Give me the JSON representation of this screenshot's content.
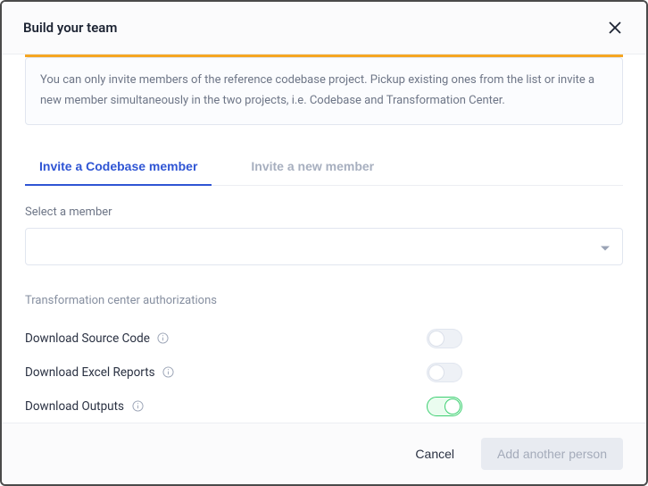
{
  "header": {
    "title": "Build your team"
  },
  "info": {
    "text": "You can only invite members of the reference codebase project. Pickup existing ones from the list or invite a new member simultaneously in the two projects, i.e. Codebase and Transformation Center."
  },
  "tabs": [
    {
      "label": "Invite a Codebase member",
      "active": true
    },
    {
      "label": "Invite a new member",
      "active": false
    }
  ],
  "memberSelect": {
    "label": "Select a member",
    "value": ""
  },
  "authSection": {
    "label": "Transformation center authorizations",
    "items": [
      {
        "label": "Download Source Code",
        "on": false
      },
      {
        "label": "Download Excel Reports",
        "on": false
      },
      {
        "label": "Download Outputs",
        "on": true
      }
    ]
  },
  "footer": {
    "cancel": "Cancel",
    "submit": "Add another person"
  },
  "colors": {
    "accent": "#f5a623",
    "primary": "#2f55d4",
    "toggleOn": "#3ecf72"
  }
}
